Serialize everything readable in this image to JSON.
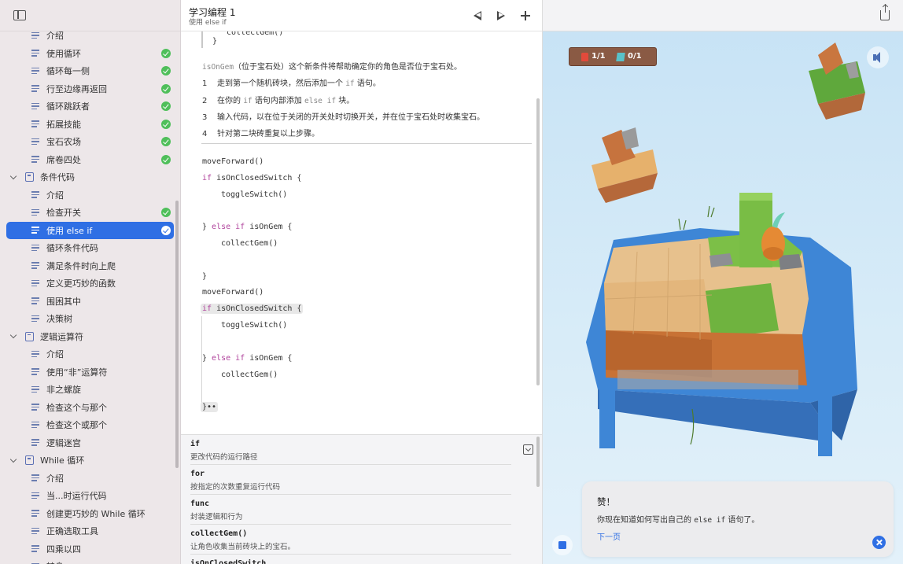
{
  "sidebar": {
    "rows": [
      {
        "type": "page",
        "label": "介绍",
        "done": false
      },
      {
        "type": "page",
        "label": "使用循环",
        "done": true
      },
      {
        "type": "page",
        "label": "循环每一侧",
        "done": true
      },
      {
        "type": "page",
        "label": "行至边缘再返回",
        "done": true
      },
      {
        "type": "page",
        "label": "循环跳跃者",
        "done": true
      },
      {
        "type": "page",
        "label": "拓展技能",
        "done": true
      },
      {
        "type": "page",
        "label": "宝石农场",
        "done": true
      },
      {
        "type": "page",
        "label": "席卷四处",
        "done": true
      },
      {
        "type": "chapter",
        "label": "条件代码",
        "done": false
      },
      {
        "type": "page",
        "label": "介绍",
        "done": false
      },
      {
        "type": "page",
        "label": "检查开关",
        "done": true
      },
      {
        "type": "page",
        "label": "使用 else if",
        "done": true,
        "selected": true
      },
      {
        "type": "page",
        "label": "循环条件代码",
        "done": false
      },
      {
        "type": "page",
        "label": "满足条件时向上爬",
        "done": false
      },
      {
        "type": "page",
        "label": "定义更巧妙的函数",
        "done": false
      },
      {
        "type": "page",
        "label": "围困其中",
        "done": false
      },
      {
        "type": "page",
        "label": "决策树",
        "done": false
      },
      {
        "type": "chapter",
        "label": "逻辑运算符",
        "done": false
      },
      {
        "type": "page",
        "label": "介绍",
        "done": false
      },
      {
        "type": "page",
        "label": "使用“非”运算符",
        "done": false
      },
      {
        "type": "page",
        "label": "非之螺旋",
        "done": false
      },
      {
        "type": "page",
        "label": "检查这个与那个",
        "done": false
      },
      {
        "type": "page",
        "label": "检查这个或那个",
        "done": false
      },
      {
        "type": "page",
        "label": "逻辑迷宫",
        "done": false
      },
      {
        "type": "chapter",
        "label": "While 循环",
        "done": false
      },
      {
        "type": "page",
        "label": "介绍",
        "done": false
      },
      {
        "type": "page",
        "label": "当...时运行代码",
        "done": false
      },
      {
        "type": "page",
        "label": "创建更巧妙的 While 循环",
        "done": false
      },
      {
        "type": "page",
        "label": "正确选取工具",
        "done": false
      },
      {
        "type": "page",
        "label": "四乘以四",
        "done": false
      },
      {
        "type": "page",
        "label": "转身",
        "done": false
      }
    ]
  },
  "editor": {
    "title": "学习编程 1",
    "subtitle": "使用 else if",
    "code_top": [
      "collectGem()",
      "}"
    ],
    "intro": {
      "code": "isOnGem",
      "text": "（位于宝石处）这个新条件将帮助确定你的角色是否位于宝石处。"
    },
    "steps": [
      {
        "num": "1",
        "pre": "走到第一个随机砖块，然后添加一个 ",
        "code": "if",
        "post": " 语句。"
      },
      {
        "num": "2",
        "pre": "在你的 ",
        "code": "if",
        "mid": " 语句内部添加 ",
        "code2": "else if",
        "post": " 块。"
      },
      {
        "num": "3",
        "pre": "输入代码，以在位于关闭的开关处时切换开关，并在位于宝石处时收集宝石。"
      },
      {
        "num": "4",
        "pre": "针对第二块砖重复以上步骤。"
      }
    ],
    "code": {
      "l1": "moveForward()",
      "l2_kw": "if",
      "l2": " isOnClosedSwitch {",
      "l3": "toggleSwitch()",
      "l4_a": "} ",
      "l4_kw": "else if",
      "l4": " isOnGem {",
      "l5": "collectGem()",
      "l6": "}",
      "l7": "moveForward()",
      "l8_kw": "if",
      "l8": " isOnClosedSwitch {",
      "l9": "toggleSwitch()",
      "l10_a": "} ",
      "l10_kw": "else if",
      "l10": " isOnGem {",
      "l11": "collectGem()",
      "l12": "}••"
    },
    "reference": [
      {
        "title": "if",
        "desc": "更改代码的运行路径"
      },
      {
        "title": "for",
        "desc": "按指定的次数重复运行代码"
      },
      {
        "title": "func",
        "desc": "封装逻辑和行为"
      },
      {
        "title": "collectGem()",
        "desc": "让角色收集当前砖块上的宝石。"
      },
      {
        "title": "isOnClosedSwitch",
        "desc": ""
      }
    ]
  },
  "game": {
    "switch_count": "1/1",
    "gem_count": "0/1",
    "toast": {
      "title": "赞！",
      "msg_pre": "你现在知道如何写出自己的 ",
      "msg_code": "else if",
      "msg_post": " 语句了。",
      "next": "下一页"
    },
    "colors": {
      "accent": "#2f6fe4",
      "check": "#4fbf5a",
      "keyword": "#b0439c"
    }
  }
}
